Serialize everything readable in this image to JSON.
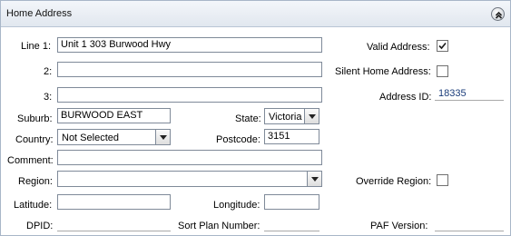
{
  "panel": {
    "title": "Home Address"
  },
  "labels": {
    "line1": "Line 1:",
    "line2": "2:",
    "line3": "3:",
    "suburb": "Suburb:",
    "state": "State:",
    "country": "Country:",
    "postcode": "Postcode:",
    "comment": "Comment:",
    "region": "Region:",
    "latitude": "Latitude:",
    "longitude": "Longitude:",
    "dpid": "DPID:",
    "sort_plan": "Sort Plan Number:",
    "paf_version": "PAF Version:",
    "valid_address": "Valid Address:",
    "silent_home_address": "Silent Home Address:",
    "address_id": "Address ID:",
    "override_region": "Override Region:"
  },
  "fields": {
    "line1": "Unit 1 303 Burwood Hwy",
    "line2": "",
    "line3": "",
    "suburb": "BURWOOD EAST",
    "state": "Victoria",
    "country": "Not Selected",
    "postcode": "3151",
    "comment": "",
    "region": "",
    "latitude": "",
    "longitude": "",
    "dpid": "",
    "sort_plan": "",
    "paf_version": "",
    "address_id": "18335"
  },
  "checkboxes": {
    "valid_address": true,
    "silent_home_address": false,
    "override_region": false
  },
  "icons": {
    "collapse": "collapse-up-icon",
    "dropdown": "chevron-down-icon",
    "check": "checkmark-icon"
  }
}
